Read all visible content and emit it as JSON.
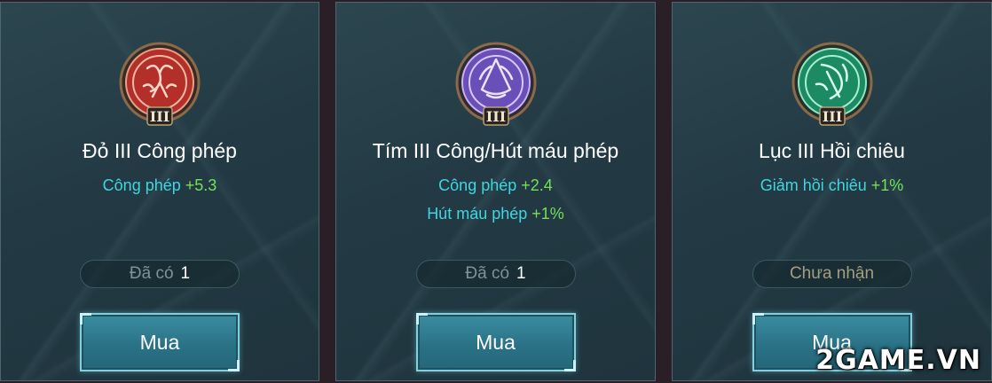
{
  "colors": {
    "stat_name": "#3fd6e0",
    "stat_value": "#74e05a",
    "gem_red": "#c8362c",
    "gem_purple": "#7b5ad0",
    "gem_green": "#1f9a6c"
  },
  "cards": [
    {
      "emblem_icon": "red-rune-icon",
      "emblem_tier": "III",
      "title": "Đỏ III Công phép",
      "stats": [
        {
          "name": "Công phép",
          "value": "+5.3"
        }
      ],
      "owned_label": "Đã có",
      "owned_count": "1",
      "buy_label": "Mua"
    },
    {
      "emblem_icon": "purple-rune-icon",
      "emblem_tier": "III",
      "title": "Tím III Công/Hút máu phép",
      "stats": [
        {
          "name": "Công phép",
          "value": "+2.4"
        },
        {
          "name": "Hút máu phép",
          "value": "+1%"
        }
      ],
      "owned_label": "Đã có",
      "owned_count": "1",
      "buy_label": "Mua"
    },
    {
      "emblem_icon": "green-rune-icon",
      "emblem_tier": "III",
      "title": "Lục III Hồi chiêu",
      "stats": [
        {
          "name": "Giảm hồi chiêu",
          "value": "+1%"
        }
      ],
      "owned_label": "Chưa nhận",
      "buy_label": "Mua"
    }
  ],
  "watermark": "2GAME.VN"
}
